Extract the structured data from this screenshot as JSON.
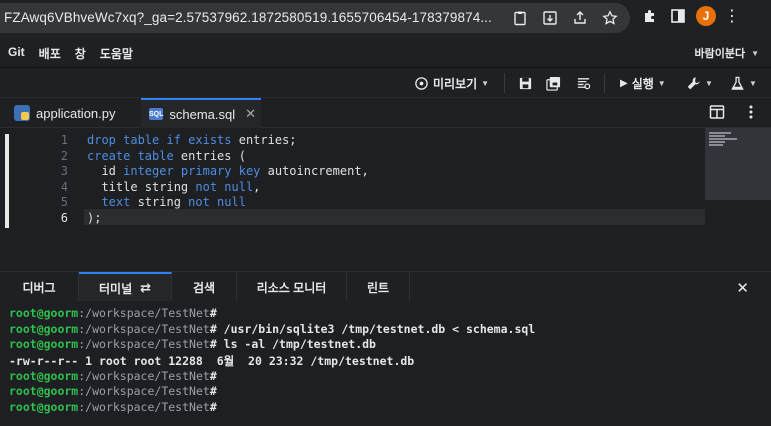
{
  "browser": {
    "url": "FZAwq6VBhveWc7xq?_ga=2.57537962.1872580519.1655706454-178379874...",
    "avatar_letter": "J"
  },
  "menubar": {
    "items": [
      "Git",
      "배포",
      "창",
      "도움말"
    ],
    "right_label": "바람이분다"
  },
  "toolbar": {
    "preview_label": "미리보기",
    "run_label": "실행"
  },
  "tabs": [
    {
      "label": "application.py",
      "icon": "python-file-icon"
    },
    {
      "label": "schema.sql",
      "icon": "sql-file-icon",
      "active": true
    }
  ],
  "editor": {
    "lines": [
      {
        "num": "1",
        "text": "drop table if exists entries;"
      },
      {
        "num": "2",
        "text": "create table entries ("
      },
      {
        "num": "3",
        "text": "  id integer primary key autoincrement,"
      },
      {
        "num": "4",
        "text": "  title string not null,"
      },
      {
        "num": "5",
        "text": "  text string not null"
      },
      {
        "num": "6",
        "text": ");"
      }
    ]
  },
  "panel": {
    "tabs": [
      "디버그",
      "터미널",
      "검색",
      "리소스 모니터",
      "린트"
    ],
    "active_tab": "터미널"
  },
  "terminal": {
    "user": "root@goorm",
    "path": ":/workspace/TestNet",
    "lines": [
      {
        "prompt": true,
        "cmd": ""
      },
      {
        "prompt": true,
        "cmd": " /usr/bin/sqlite3 /tmp/testnet.db < schema.sql"
      },
      {
        "prompt": true,
        "cmd": " ls -al /tmp/testnet.db"
      },
      {
        "prompt": false,
        "text": "-rw-r--r-- 1 root root 12288  6월  20 23:32 /tmp/testnet.db"
      },
      {
        "prompt": true,
        "cmd": ""
      },
      {
        "prompt": true,
        "cmd": ""
      },
      {
        "prompt": true,
        "cmd": ""
      }
    ]
  },
  "colors": {
    "accent": "#2f81f7",
    "keyword": "#4f8de0",
    "prompt_user": "#2fbf4e",
    "avatar": "#e8710a"
  }
}
